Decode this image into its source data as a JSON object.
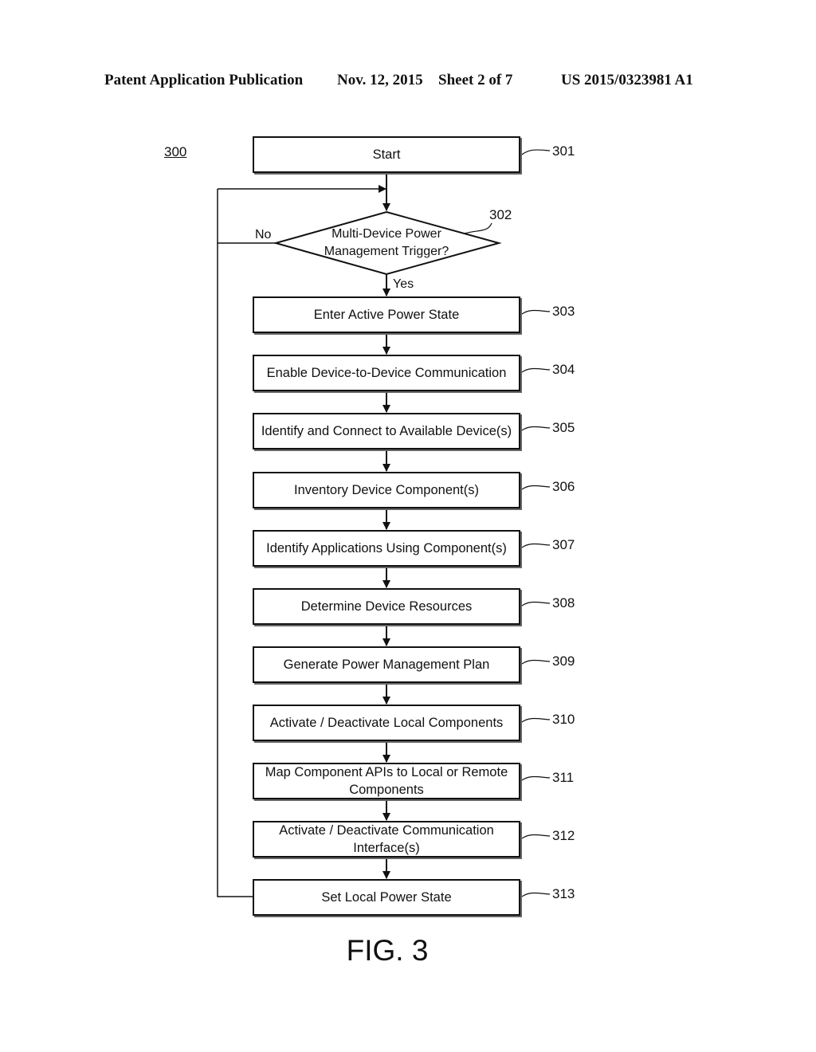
{
  "header": {
    "publication": "Patent Application Publication",
    "date": "Nov. 12, 2015",
    "sheet": "Sheet 2 of 7",
    "number": "US 2015/0323981 A1"
  },
  "figure": {
    "ref": "300",
    "caption": "FIG. 3",
    "start": {
      "label": "Start",
      "ref": "301"
    },
    "decision": {
      "label_line1": "Multi-Device Power",
      "label_line2": "Management Trigger?",
      "ref": "302",
      "no_label": "No",
      "yes_label": "Yes"
    },
    "steps": [
      {
        "label": "Enter Active Power State",
        "ref": "303"
      },
      {
        "label": "Enable Device-to-Device Communication",
        "ref": "304"
      },
      {
        "label": "Identify and Connect to Available Device(s)",
        "ref": "305"
      },
      {
        "label": "Inventory Device Component(s)",
        "ref": "306"
      },
      {
        "label": "Identify Applications Using Component(s)",
        "ref": "307"
      },
      {
        "label": "Determine Device Resources",
        "ref": "308"
      },
      {
        "label": "Generate Power Management Plan",
        "ref": "309"
      },
      {
        "label": "Activate / Deactivate Local Components",
        "ref": "310"
      },
      {
        "label": "Map Component APIs to Local or Remote Components",
        "ref": "311"
      },
      {
        "label": "Activate / Deactivate Communication Interface(s)",
        "ref": "312"
      },
      {
        "label": "Set Local Power State",
        "ref": "313"
      }
    ]
  }
}
